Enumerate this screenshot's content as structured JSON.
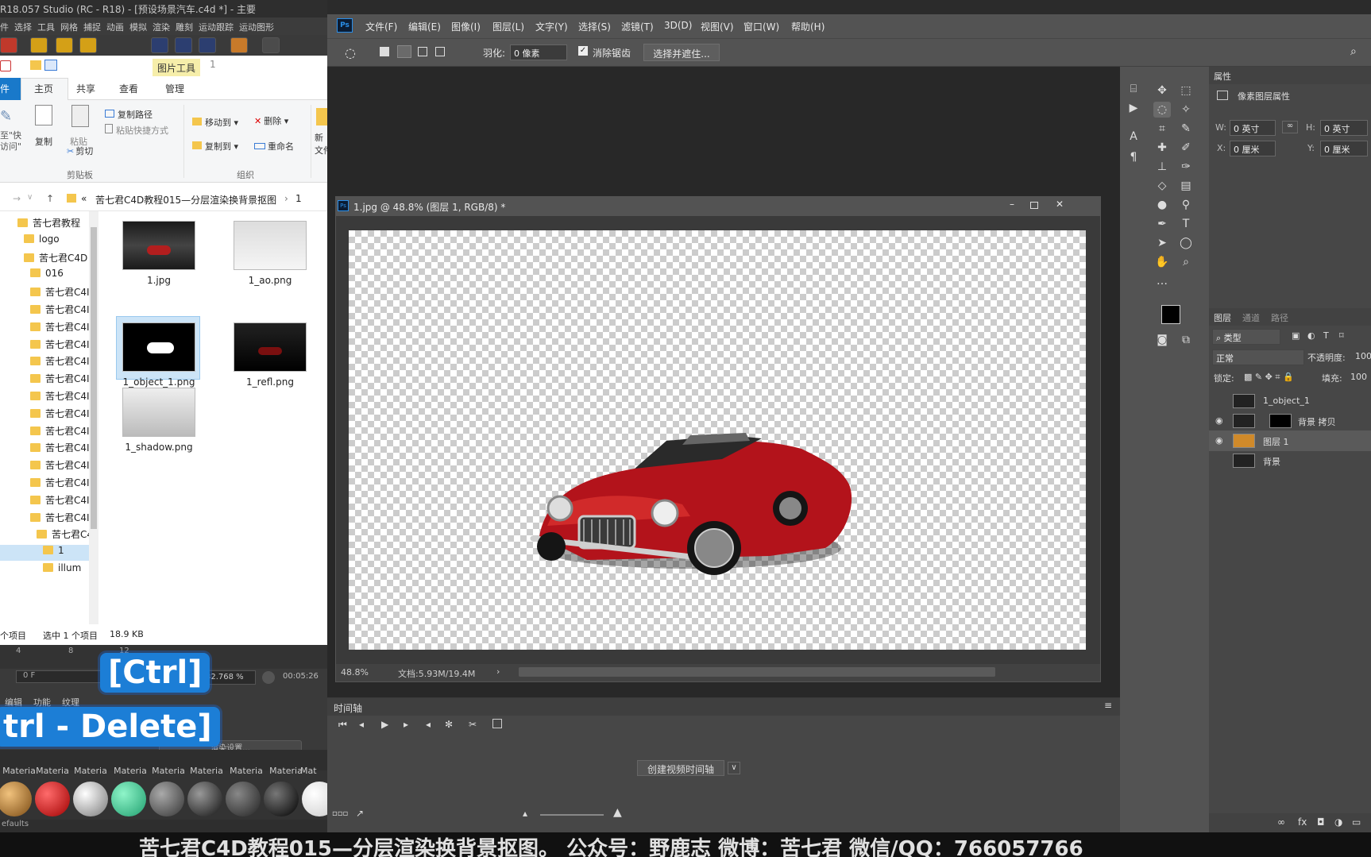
{
  "c4d": {
    "title": "R18.057 Studio (RC - R18) - [预设场景汽车.c4d *] - 主要",
    "menu": [
      "件",
      "选择",
      "工具",
      "网格",
      "捕捉",
      "动画",
      "模拟",
      "渲染",
      "雕刻",
      "运动跟踪",
      "运动图形"
    ],
    "timeline_ticks": [
      "4",
      "8",
      "12"
    ],
    "frame_field": "0 F",
    "zoom": "32.768 %",
    "time": "00:05:26",
    "lower_tabs": [
      "编辑",
      "功能",
      "纹理"
    ],
    "render_settings": "渲染设置...",
    "mat_label": "Materia",
    "mat_label_cut": "Mat",
    "status": "efaults"
  },
  "explorer": {
    "picture_tools": "图片工具",
    "path_one": "1",
    "tabs": [
      "件",
      "主页",
      "共享",
      "查看",
      "管理"
    ],
    "ribbon": {
      "pin": "至\"快\n访问\"",
      "copy": "复制",
      "paste": "粘贴",
      "copy_path": "复制路径",
      "paste_shortcut": "粘贴快捷方式",
      "cut": "剪切",
      "move_to": "移动到",
      "copy_to": "复制到",
      "delete": "删除",
      "rename": "重命名",
      "new_folder": "新\n文件",
      "clipboard_group": "剪贴板",
      "organize_group": "组织"
    },
    "address": [
      "«",
      "苦七君C4D教程015—分层渲染换背景抠图",
      "›",
      "1"
    ],
    "tree": [
      {
        "label": "苦七君教程",
        "indent": 0
      },
      {
        "label": "logo",
        "indent": 1
      },
      {
        "label": "苦七君C4D",
        "indent": 1
      },
      {
        "label": "016",
        "indent": 2
      },
      {
        "label": "苦七君C4I",
        "indent": 2
      },
      {
        "label": "苦七君C4I",
        "indent": 2
      },
      {
        "label": "苦七君C4I",
        "indent": 2
      },
      {
        "label": "苦七君C4I",
        "indent": 2
      },
      {
        "label": "苦七君C4I",
        "indent": 2
      },
      {
        "label": "苦七君C4I",
        "indent": 2
      },
      {
        "label": "苦七君C4I",
        "indent": 2
      },
      {
        "label": "苦七君C4I",
        "indent": 2
      },
      {
        "label": "苦七君C4I",
        "indent": 2
      },
      {
        "label": "苦七君C4I",
        "indent": 2
      },
      {
        "label": "苦七君C4I",
        "indent": 2
      },
      {
        "label": "苦七君C4I",
        "indent": 2
      },
      {
        "label": "苦七君C4I",
        "indent": 2
      },
      {
        "label": "苦七君C4I",
        "indent": 2
      },
      {
        "label": "苦七君C4",
        "indent": 3
      },
      {
        "label": "1",
        "indent": 4
      },
      {
        "label": "illum",
        "indent": 4
      }
    ],
    "files": [
      "1.jpg",
      "1_ao.png",
      "1_object_1.png",
      "1_refl.png",
      "1_shadow.png"
    ],
    "status": {
      "count": "个项目",
      "selected": "选中 1 个项目",
      "size": "18.9 KB"
    }
  },
  "keycaps": {
    "ctrl": "[Ctrl]",
    "delete": "trl - Delete]"
  },
  "ps": {
    "menu": [
      "文件(F)",
      "编辑(E)",
      "图像(I)",
      "图层(L)",
      "文字(Y)",
      "选择(S)",
      "滤镜(T)",
      "3D(D)",
      "视图(V)",
      "窗口(W)",
      "帮助(H)"
    ],
    "options": {
      "feather_label": "羽化:",
      "feather_value": "0 像素",
      "antialias": "消除锯齿",
      "select_mask": "选择并遮住..."
    },
    "document": {
      "title": "1.jpg @ 48.8% (图层 1, RGB/8) *",
      "zoom": "48.8%",
      "doc_info": "文档:5.93M/19.4M"
    },
    "timeline": {
      "title": "时间轴",
      "create": "创建视频时间轴"
    },
    "properties": {
      "title": "属性",
      "subtitle": "像素图层属性",
      "w_label": "W:",
      "w_value": "0 英寸",
      "h_label": "H:",
      "h_value": "0 英寸",
      "x_label": "X:",
      "x_value": "0 厘米",
      "y_label": "Y:",
      "y_value": "0 厘米"
    },
    "layers_panel": {
      "tabs": [
        "图层",
        "通道",
        "路径"
      ],
      "filter": "类型",
      "blend": "正常",
      "opacity_label": "不透明度:",
      "opacity_value": "100",
      "lock_label": "锁定:",
      "fill_label": "填充:",
      "fill_value": "100",
      "layers": [
        {
          "name": "1_object_1",
          "visible": false
        },
        {
          "name": "背景 拷贝",
          "visible": true
        },
        {
          "name": "图层 1",
          "visible": true,
          "selected": true
        },
        {
          "name": "背景",
          "visible": false
        }
      ]
    }
  },
  "subtitle": "苦七君C4D教程015—分层渲染换背景抠图。  公众号：野鹿志   微博：苦七君   微信/QQ：766057766"
}
